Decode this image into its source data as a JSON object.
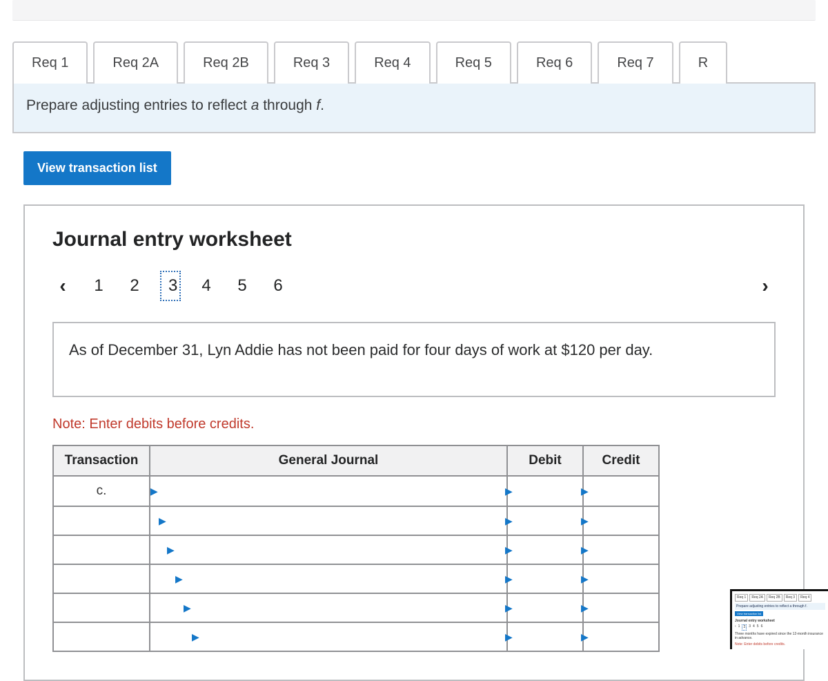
{
  "tabs": [
    "Req 1",
    "Req 2A",
    "Req 2B",
    "Req 3",
    "Req 4",
    "Req 5",
    "Req 6",
    "Req 7",
    "R"
  ],
  "active_tab_index": 1,
  "instruction_prefix": "Prepare adjusting entries to reflect ",
  "instruction_em1": "a",
  "instruction_mid": " through ",
  "instruction_em2": "f",
  "instruction_suffix": ".",
  "view_btn": "View transaction list",
  "ws_title": "Journal entry worksheet",
  "pager": {
    "pages": [
      "1",
      "2",
      "3",
      "4",
      "5",
      "6"
    ],
    "current_index": 2
  },
  "scenario": "As of December 31, Lyn Addie has not been paid for four days of work at $120 per day.",
  "note": "Note: Enter debits before credits.",
  "table": {
    "headers": {
      "transaction": "Transaction",
      "gj": "General Journal",
      "debit": "Debit",
      "credit": "Credit"
    },
    "rows": [
      {
        "trans": "c.",
        "gj": "",
        "debit": "",
        "credit": ""
      },
      {
        "trans": "",
        "gj": "",
        "debit": "",
        "credit": ""
      },
      {
        "trans": "",
        "gj": "",
        "debit": "",
        "credit": ""
      },
      {
        "trans": "",
        "gj": "",
        "debit": "",
        "credit": ""
      },
      {
        "trans": "",
        "gj": "",
        "debit": "",
        "credit": ""
      },
      {
        "trans": "",
        "gj": "",
        "debit": "",
        "credit": ""
      }
    ]
  },
  "thumb": {
    "tabs": [
      "Req 1",
      "Req 2A",
      "Req 2B",
      "Req 3",
      "Req 4"
    ],
    "instruction": "Prepare adjusting entries to reflect a through f.",
    "btn": "View transaction list",
    "title": "Journal entry worksheet",
    "pages": [
      "1",
      "2",
      "3",
      "4",
      "5",
      "6"
    ],
    "current": 1,
    "text": "Three months have expired since the 12-month insurance in advance.",
    "note": "Note: Enter debits before credits."
  }
}
